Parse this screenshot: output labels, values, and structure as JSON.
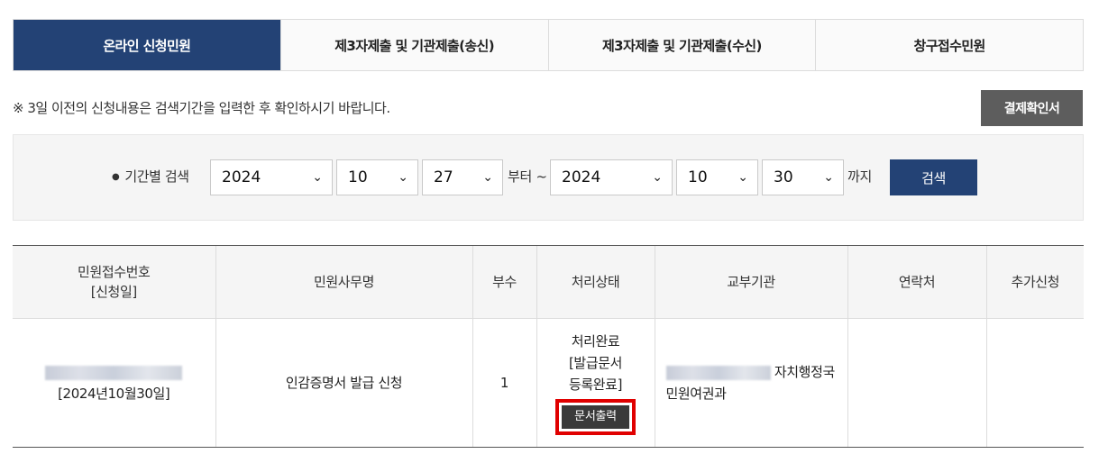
{
  "tabs": [
    {
      "label": "온라인 신청민원",
      "active": true
    },
    {
      "label": "제3자제출 및 기관제출(송신)",
      "active": false
    },
    {
      "label": "제3자제출 및 기관제출(수신)",
      "active": false
    },
    {
      "label": "창구접수민원",
      "active": false
    }
  ],
  "notice": "※ 3일 이전의 신청내용은 검색기간을 입력한 후 확인하시기 바랍니다.",
  "confirm_button": "결제확인서",
  "search": {
    "label": "기간별 검색",
    "from_year": "2024",
    "from_month": "10",
    "from_day": "27",
    "from_suffix": "부터 ~",
    "to_year": "2024",
    "to_month": "10",
    "to_day": "30",
    "to_suffix": "까지",
    "button": "검색"
  },
  "table": {
    "headers": {
      "receipt_line1": "민원접수번호",
      "receipt_line2": "[신청일]",
      "name": "민원사무명",
      "copies": "부수",
      "status": "처리상태",
      "agency": "교부기관",
      "contact": "연락처",
      "extra": "추가신청"
    },
    "rows": [
      {
        "receipt_date": "[2024년10월30일]",
        "name": "인감증명서 발급 신청",
        "copies": "1",
        "status_line1": "처리완료",
        "status_line2": "[발급문서",
        "status_line3": "등록완료]",
        "print_button": "문서출력",
        "agency_line1": "자치행정국",
        "agency_line2": "민원여권과",
        "contact": "",
        "extra": ""
      }
    ]
  },
  "colors": {
    "primary": "#234275",
    "dark_button": "#5d5d5d",
    "highlight": "#e00000"
  }
}
